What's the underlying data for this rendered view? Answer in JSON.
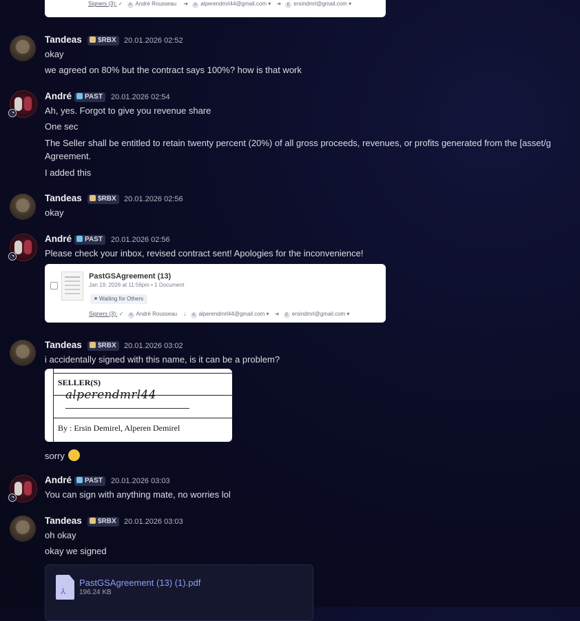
{
  "top_card": {
    "signers_label": "Signers (3):",
    "signer1": "André Rousseau",
    "signer2": "alperendmrl44@gmail.com",
    "signer3": "ersindmrl@gmail.com"
  },
  "messages": [
    {
      "author": "Tandeas",
      "tag": "$RBX",
      "time": "20.01.2026 02:52",
      "lines": [
        "okay",
        "we agreed on 80% but the contract says 100%? how is that work"
      ]
    },
    {
      "author": "André",
      "tag": "PAST",
      "time": "20.01.2026 02:54",
      "lines": [
        "Ah, yes. Forgot to give you revenue share",
        "One sec",
        "The Seller shall be entitled to retain twenty percent (20%) of all gross proceeds, revenues, or profits generated from the [asset/g",
        "Agreement.",
        "I added this"
      ]
    },
    {
      "author": "Tandeas",
      "tag": "$RBX",
      "time": "20.01.2026 02:56",
      "lines": [
        "okay"
      ]
    },
    {
      "author": "André",
      "tag": "PAST",
      "time": "20.01.2026 02:56",
      "lines": [
        "Please check your inbox, revised contract sent! Apologies for the inconvenience!"
      ]
    },
    {
      "author": "Tandeas",
      "tag": "$RBX",
      "time": "20.01.2026 03:02",
      "lines": [
        "i accidentally signed with this name, is it can be a problem?",
        "sorry"
      ]
    },
    {
      "author": "André",
      "tag": "PAST",
      "time": "20.01.2026 03:03",
      "lines": [
        "You can sign with anything mate, no worries lol"
      ]
    },
    {
      "author": "Tandeas",
      "tag": "$RBX",
      "time": "20.01.2026 03:03",
      "lines": [
        "oh okay",
        "okay we signed"
      ]
    }
  ],
  "doc_card": {
    "title": "PastGSAgreement (13)",
    "meta": "Jan 19, 2026 at 11:56pm • 1 Document",
    "status": "Waiting for Others",
    "signers_label": "Signers (3):",
    "signer1": "André Rousseau",
    "signer2": "alperendmrl44@gmail.com",
    "signer3": "ersindmrl@gmail.com"
  },
  "signature_image": {
    "heading": "SELLER(S)",
    "signature": "alperendmrl44",
    "by_line": "By : Ersin Demirel, Alperen Demirel"
  },
  "emoji": "🫣",
  "attachment": {
    "filename": "PastGSAgreement (13) (1).pdf",
    "size": "196.24 KB"
  }
}
